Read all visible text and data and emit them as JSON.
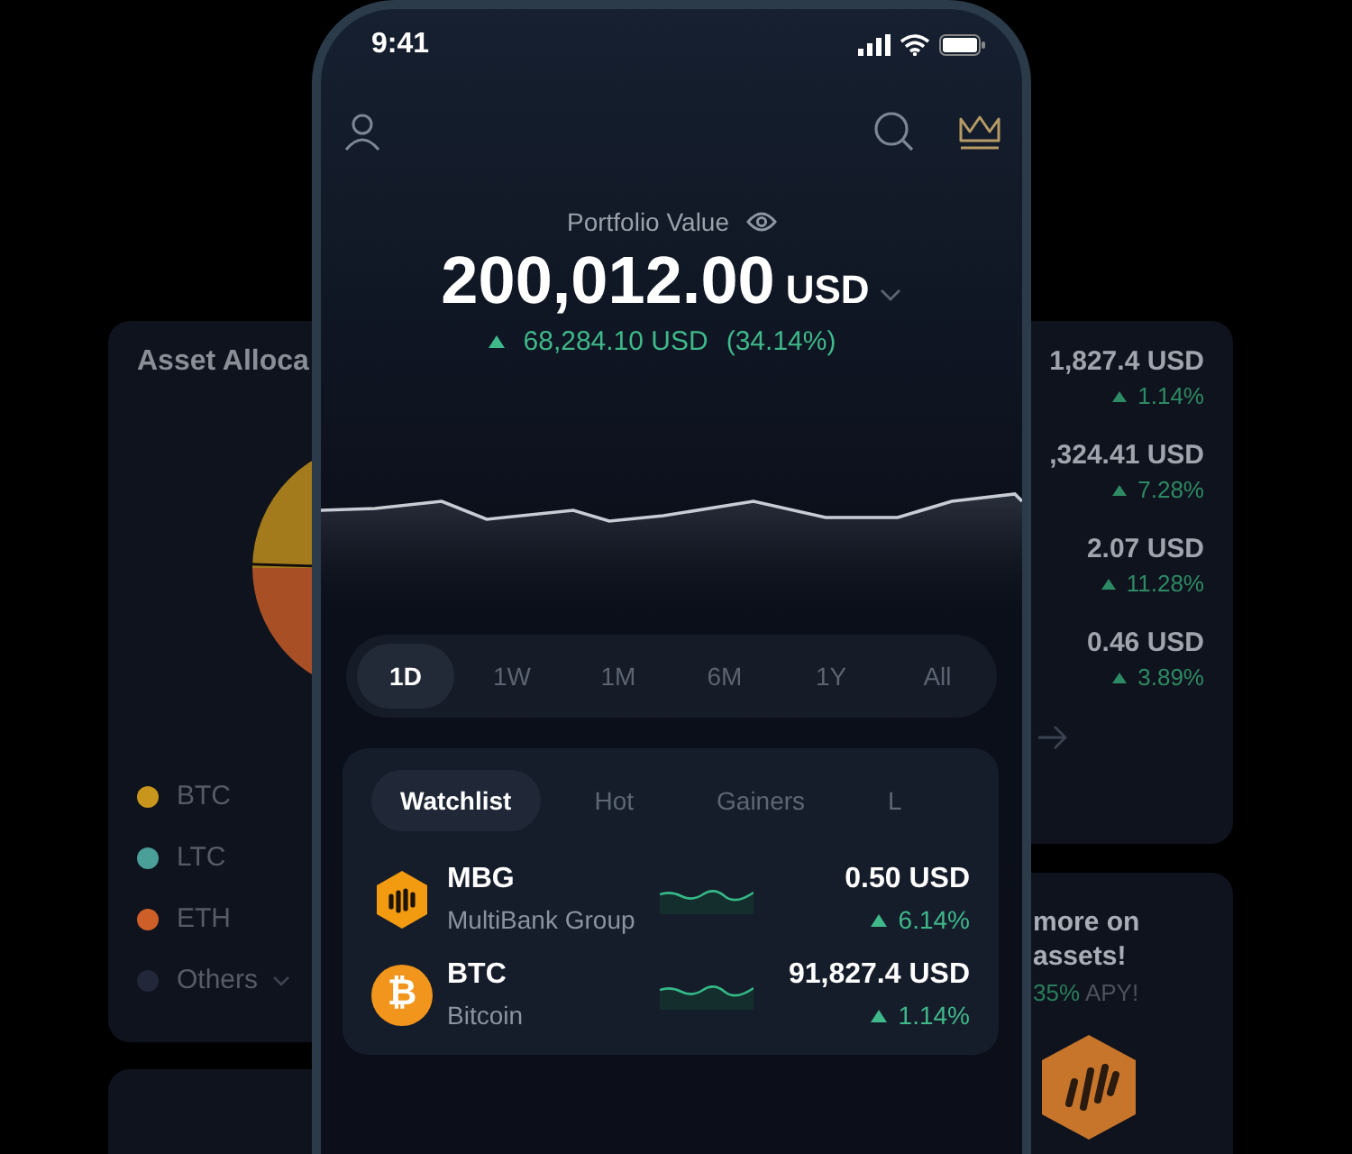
{
  "allocation_card": {
    "title": "Asset Alloca",
    "legend": [
      {
        "label": "BTC",
        "color": "#c8961c"
      },
      {
        "label": "LTC",
        "color": "#4a9f98"
      },
      {
        "label": "ETH",
        "color": "#cf5f28"
      },
      {
        "label": "Others",
        "color": "#22283a",
        "expandable": true
      }
    ]
  },
  "prices_card": {
    "rows": [
      {
        "value": "1,827.4 USD",
        "change": "1.14%"
      },
      {
        "value": ",324.41 USD",
        "change": "7.28%"
      },
      {
        "value": "2.07 USD",
        "change": "11.28%"
      },
      {
        "value": "0.46 USD",
        "change": "3.89%"
      }
    ]
  },
  "promo_card": {
    "lines": [
      "more on",
      "assets!"
    ],
    "apy_rate": "35%",
    "apy_label": "APY!"
  },
  "status_bar": {
    "time": "9:41"
  },
  "portfolio": {
    "label": "Portfolio Value",
    "value": "200,012.00",
    "currency": "USD",
    "change": "68,284.10 USD",
    "change_percent": "(34.14%)"
  },
  "periods": [
    {
      "label": "1D",
      "selected": true
    },
    {
      "label": "1W",
      "selected": false
    },
    {
      "label": "1M",
      "selected": false
    },
    {
      "label": "6M",
      "selected": false
    },
    {
      "label": "1Y",
      "selected": false
    },
    {
      "label": "All",
      "selected": false
    }
  ],
  "list_tabs": [
    {
      "label": "Watchlist",
      "selected": true
    },
    {
      "label": "Hot",
      "selected": false
    },
    {
      "label": "Gainers",
      "selected": false
    },
    {
      "label": "L",
      "selected": false
    }
  ],
  "assets": [
    {
      "symbol": "MBG",
      "name": "MultiBank Group",
      "price": "0.50 USD",
      "change": "6.14%",
      "kind": "hexagon"
    },
    {
      "symbol": "BTC",
      "name": "Bitcoin",
      "price": "91,827.4 USD",
      "change": "1.14%",
      "kind": "coin",
      "glyph": "₿"
    }
  ]
}
